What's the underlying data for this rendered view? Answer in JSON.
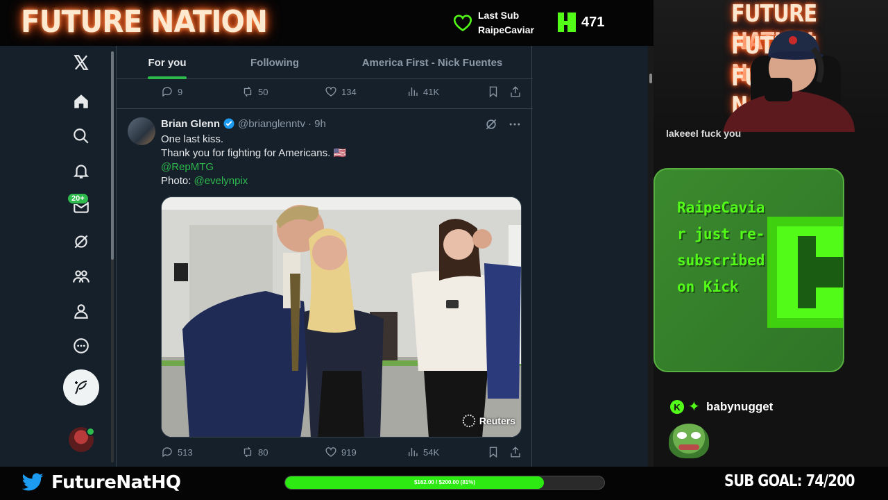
{
  "overlay": {
    "brand": "FUTURE NATION",
    "last_sub_label": "Last Sub",
    "last_sub_name": "RaipeCaviar",
    "kick_follower_count": "471",
    "twitter_handle": "FutureNatHQ",
    "goal_progress_text": "$162.00 / $200.00 (81%)",
    "goal_progress_fraction": 0.81,
    "sub_goal": "SUB GOAL: 74/200",
    "cam_neon": [
      "FUTURE NATION",
      "FUTURE NATION",
      "FUTURE NATION"
    ],
    "accent_color": "#53fc18"
  },
  "nav": {
    "items": [
      "x-logo-icon",
      "home-icon",
      "search-icon",
      "notifications-icon",
      "messages-icon",
      "grok-icon",
      "communities-icon",
      "profile-icon",
      "more-icon"
    ],
    "messages_badge": "20+"
  },
  "tabs": [
    {
      "label": "For you",
      "active": true
    },
    {
      "label": "Following",
      "active": false
    },
    {
      "label": "America First - Nick Fuentes",
      "active": false
    }
  ],
  "prev_tweet_actions": {
    "replies": "9",
    "reposts": "50",
    "likes": "134",
    "views": "41K"
  },
  "tweet": {
    "name": "Brian Glenn",
    "handle": "@brianglenntv",
    "time": "· 9h",
    "text_line1": "One last kiss.",
    "text_line2": "Thank you for fighting for Americans. 🇺🇸",
    "mention": "@RepMTG",
    "photo_label": "Photo:",
    "photo_credit": "@evelynpix",
    "media_watermark": "Reuters",
    "actions": {
      "replies": "513",
      "reposts": "80",
      "likes": "919",
      "views": "54K"
    }
  },
  "chat": {
    "previous_line": "lakeeel fuck you",
    "alert_text": "RaipeCaviar just re-subscribed on Kick",
    "user": "babynugget"
  }
}
